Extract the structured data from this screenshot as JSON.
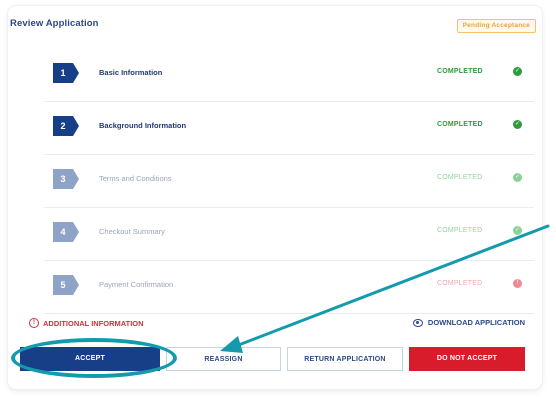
{
  "page": {
    "title": "Review Application",
    "status_badge": "Pending Acceptance"
  },
  "steps": [
    {
      "number": "1",
      "label": "Basic Information",
      "status": "COMPLETED",
      "state": "active"
    },
    {
      "number": "2",
      "label": "Background Information",
      "status": "COMPLETED",
      "state": "active"
    },
    {
      "number": "3",
      "label": "Terms and Conditions",
      "status": "COMPLETED",
      "state": "muted"
    },
    {
      "number": "4",
      "label": "Checkout Summary",
      "status": "COMPLETED",
      "state": "muted"
    },
    {
      "number": "5",
      "label": "Payment Confirmation",
      "status": "COMPLETED",
      "state": "muted-error"
    }
  ],
  "info": {
    "additional_information": "ADDITIONAL INFORMATION",
    "download_application": "DOWNLOAD APPLICATION"
  },
  "actions": {
    "accept": "ACCEPT",
    "reassign": "REASSIGN",
    "return_application": "RETURN APPLICATION",
    "do_not_accept": "DO NOT ACCEPT"
  },
  "icons": {
    "step_check": "check-circle-icon",
    "additional_info": "warning-circle-icon",
    "download": "eye-icon"
  },
  "colors": {
    "primary": "#173f87",
    "completed": "#2e9b3c",
    "danger": "#d91c2b",
    "pending": "#e8a23c",
    "annotation": "#139bad"
  }
}
